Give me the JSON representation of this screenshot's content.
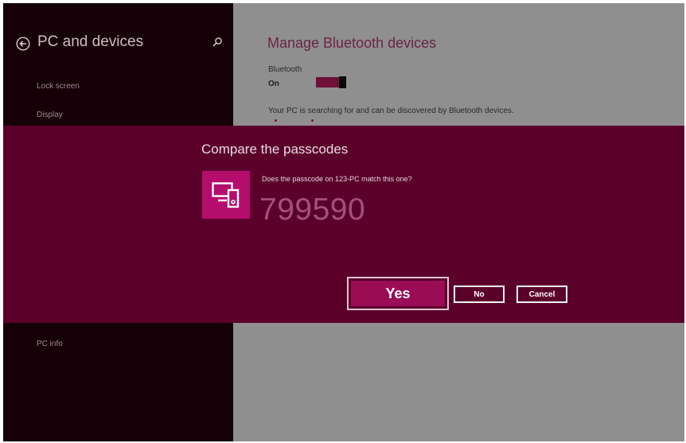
{
  "sidebar": {
    "title": "PC and devices",
    "items": [
      {
        "label": "Lock screen"
      },
      {
        "label": "Display"
      },
      {
        "label": "PC info"
      }
    ]
  },
  "main": {
    "title": "Manage Bluetooth devices",
    "bluetooth_label": "Bluetooth",
    "bluetooth_state": "On",
    "status_text": "Your PC is searching for and can be discovered by Bluetooth devices."
  },
  "dialog": {
    "title": "Compare the passcodes",
    "question": "Does the passcode on 123-PC match this one?",
    "passcode": "799590",
    "yes_label": "Yes",
    "no_label": "No",
    "cancel_label": "Cancel"
  },
  "icons": {
    "back": "back-arrow-icon",
    "search": "search-icon",
    "device": "devices-icon"
  },
  "colors": {
    "accent": "#5b002b",
    "tile": "#b40d6d",
    "yes_button": "#9b0c57",
    "sidebar_bg": "#160008",
    "content_bg": "#8f8f8f",
    "title_color": "#6a2446"
  }
}
